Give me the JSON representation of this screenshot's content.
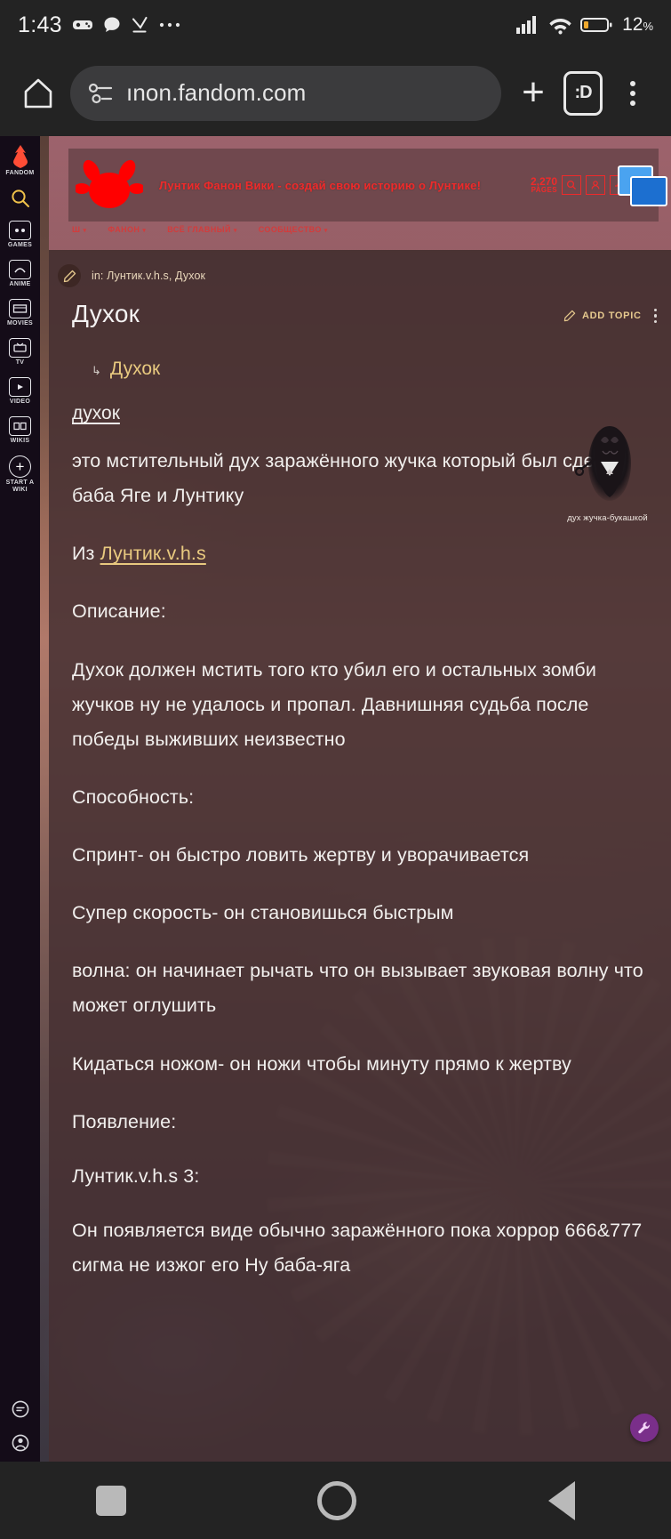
{
  "status_bar": {
    "time": "1:43",
    "icons": [
      "game-controller-icon",
      "chat-bubble-icon",
      "download-check-icon",
      "more-dots-icon"
    ],
    "signal_icon": "cellular-signal-icon",
    "wifi_icon": "wifi-icon",
    "battery_icon": "battery-low-icon",
    "battery_level": "12",
    "battery_unit": "%"
  },
  "browser": {
    "home_icon": "home-icon",
    "site_settings_icon": "page-info-icon",
    "url": "ınon.fandom.com",
    "new_tab_label": "+",
    "tab_switcher_label": ":D",
    "menu_icon": "kebab-menu-icon"
  },
  "rail": {
    "items": [
      {
        "icon": "fandom-flame-icon",
        "label": "FANDOM"
      },
      {
        "icon": "search-icon",
        "label": ""
      },
      {
        "icon": "games-icon",
        "label": "GAMES"
      },
      {
        "icon": "anime-icon",
        "label": "ANIME"
      },
      {
        "icon": "movies-icon",
        "label": "MOVIES"
      },
      {
        "icon": "tv-icon",
        "label": "TV"
      },
      {
        "icon": "video-icon",
        "label": "VIDEO"
      },
      {
        "icon": "wikis-icon",
        "label": "WIKIS"
      },
      {
        "icon": "plus-icon",
        "label": "START A WIKI"
      }
    ],
    "bottom": [
      {
        "icon": "notifications-icon"
      },
      {
        "icon": "account-icon"
      }
    ]
  },
  "wiki_header": {
    "logo_icon": "luntik-logo-icon",
    "title": "Лунтик Фанон Вики - создай свою историю о Лунтике!",
    "pages_number": "2,270",
    "pages_label": "PAGES",
    "buttons": [
      "search-icon",
      "user-icon",
      "activity-icon",
      "menu-icon"
    ],
    "nav": [
      {
        "label": "Ш",
        "caret": "▾"
      },
      {
        "label": "ФАНОН",
        "caret": "▾"
      },
      {
        "label": "ВСЁ ГЛАВНЫЙ",
        "caret": "▾"
      },
      {
        "label": "СООБЩЕСТВО",
        "caret": "▾"
      }
    ]
  },
  "article": {
    "breadcrumb_icon": "edit-pencil-icon",
    "breadcrumb_prefix": "in:",
    "breadcrumb_text": "Лунтик.v.h.s, Духок",
    "title": "Духок",
    "add_topic_icon": "edit-pencil-icon",
    "add_topic_label": "ADD TOPIC",
    "more_icon": "kebab-menu-icon",
    "sub_link_arrow": "↳",
    "sub_link": "Духок",
    "lead_underlined": "духок",
    "paragraphs": [
      "это мстительный дух заражённого жучка который был сделан баба Яге и Лунтику",
      "Описание:",
      "Духок должен мстить того кто убил его и остальных зомби жучков ну не удалось и пропал. Давнишняя судьба после победы выживших неизвестно",
      "Способность:",
      "Спринт- он быстро ловить жертву и уворачивается",
      "Супер скорость- он становишься быстрым",
      "волна: он начинает рычать что он вызывает звуковая волну что может оглушить",
      "Кидаться ножом- он ножи чтобы минуту прямо к жертву",
      "Появление:",
      "Лунтик.v.h.s 3:",
      "Он появляется виде обычно заражённого пока хоррор 666&777 сигма не изжог его Ну баба-яга"
    ],
    "source_prefix": "Из",
    "source_link": "Лунтик.v.h.s",
    "figure_caption": "дух жучка-букашкой",
    "figure_icon": "dark-spirit-figure-icon",
    "fab_icon": "wrench-icon"
  },
  "nav_bar": {
    "recents_icon": "square-recents-icon",
    "home_icon": "circle-home-icon",
    "back_icon": "triangle-back-icon"
  },
  "colors": {
    "accent_red": "#ef2a2a",
    "accent_gold": "#e8c97f",
    "chrome_bg": "#232323",
    "rail_bg": "#140c18",
    "article_bg": "#463032"
  }
}
